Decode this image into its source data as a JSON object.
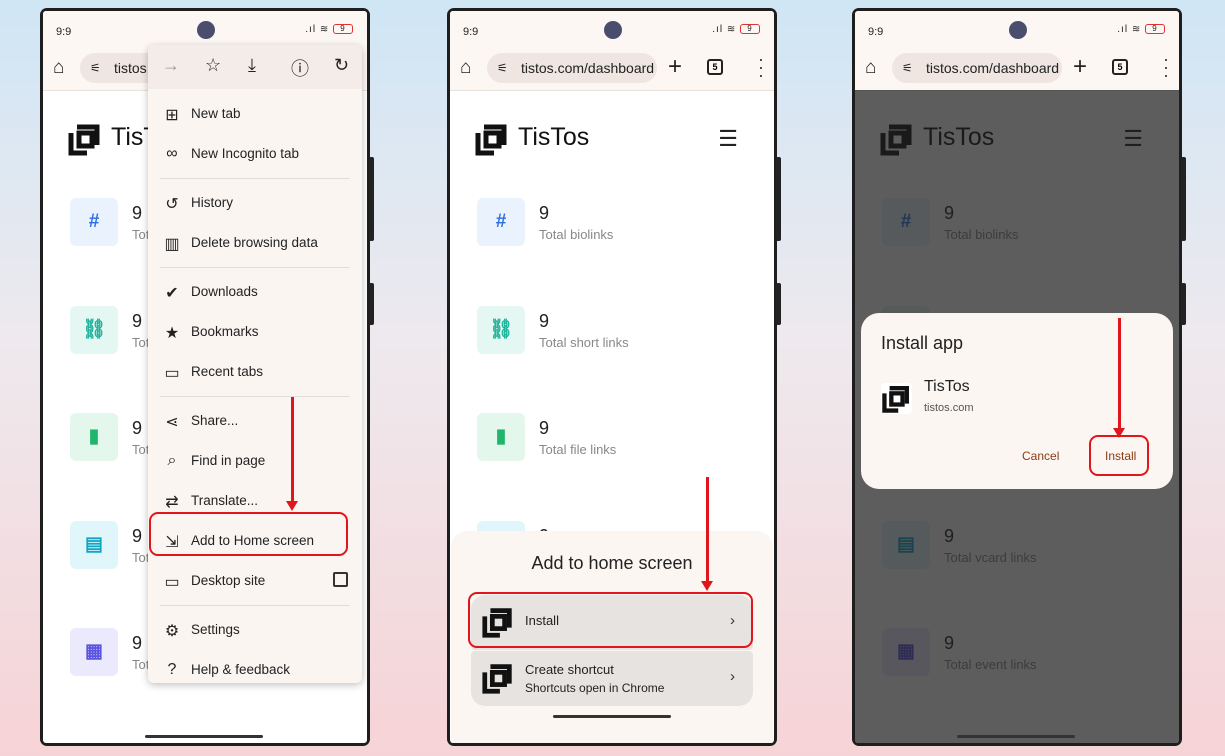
{
  "status": {
    "time": "9:9",
    "battery": "9",
    "signal_icon": "signal-icon",
    "wifi_icon": "wifi-icon"
  },
  "browser": {
    "url": "tistos.com/dashboard",
    "url_truncated": "tistos.c",
    "tabs_count": "5"
  },
  "site": {
    "brand": "TisTos",
    "stats": [
      {
        "value": "9",
        "label": "Total biolinks",
        "label_short": "Tot",
        "icon": "#",
        "icon_name": "hash-icon",
        "color": "#2f6fe0",
        "bg": "#eaf2fd"
      },
      {
        "value": "9",
        "label": "Total short links",
        "label_short": "Tot",
        "icon": "⛓",
        "icon_name": "link-icon",
        "color": "#1db39a",
        "bg": "#e4f7f3"
      },
      {
        "value": "9",
        "label": "Total file links",
        "label_short": "Tot",
        "icon": "▮",
        "icon_name": "file-icon",
        "color": "#1fb56a",
        "bg": "#e4f7ec"
      },
      {
        "value": "9",
        "label": "Total vcard links",
        "label_short": "Tot",
        "icon": "▤",
        "icon_name": "vcard-icon",
        "color": "#10a5c4",
        "bg": "#e1f6fb"
      },
      {
        "value": "9",
        "label": "Total event links",
        "label_short": "Tot",
        "icon": "▦",
        "icon_name": "calendar-icon",
        "color": "#5a52e0",
        "bg": "#ebeafd"
      }
    ]
  },
  "menu": {
    "toolbar": [
      {
        "icon": "→",
        "name": "forward-icon"
      },
      {
        "icon": "☆",
        "name": "star-icon"
      },
      {
        "icon": "⤓",
        "name": "download-icon"
      },
      {
        "icon": "ⓘ",
        "name": "info-icon"
      },
      {
        "icon": "↻",
        "name": "reload-icon"
      }
    ],
    "items": [
      {
        "label": "New tab",
        "icon": "⊞",
        "name": "new-tab-icon"
      },
      {
        "label": "New Incognito tab",
        "icon": "∞",
        "name": "incognito-icon"
      },
      {
        "label": "History",
        "icon": "↺",
        "name": "history-icon"
      },
      {
        "label": "Delete browsing data",
        "icon": "▥",
        "name": "trash-icon"
      },
      {
        "label": "Downloads",
        "icon": "✔",
        "name": "downloads-icon"
      },
      {
        "label": "Bookmarks",
        "icon": "★",
        "name": "bookmarks-icon"
      },
      {
        "label": "Recent tabs",
        "icon": "▭",
        "name": "recent-tabs-icon"
      },
      {
        "label": "Share...",
        "icon": "⋖",
        "name": "share-icon"
      },
      {
        "label": "Find in page",
        "icon": "⌕",
        "name": "find-icon"
      },
      {
        "label": "Translate...",
        "icon": "⇄",
        "name": "translate-icon"
      },
      {
        "label": "Add to Home screen",
        "icon": "⇲",
        "name": "add-to-home-icon"
      },
      {
        "label": "Desktop site",
        "icon": "▭",
        "name": "desktop-icon"
      },
      {
        "label": "Settings",
        "icon": "⚙",
        "name": "settings-icon"
      },
      {
        "label": "Help & feedback",
        "icon": "?",
        "name": "help-icon"
      }
    ]
  },
  "sheet": {
    "title": "Add to home screen",
    "options": [
      {
        "label": "Install",
        "sub": ""
      },
      {
        "label": "Create shortcut",
        "sub": "Shortcuts open in Chrome"
      }
    ]
  },
  "dialog": {
    "title": "Install app",
    "app_name": "TisTos",
    "app_domain": "tistos.com",
    "cancel": "Cancel",
    "install": "Install"
  },
  "colors": {
    "highlight": "#e0161c",
    "accent_button_text": "#8a3b12"
  }
}
